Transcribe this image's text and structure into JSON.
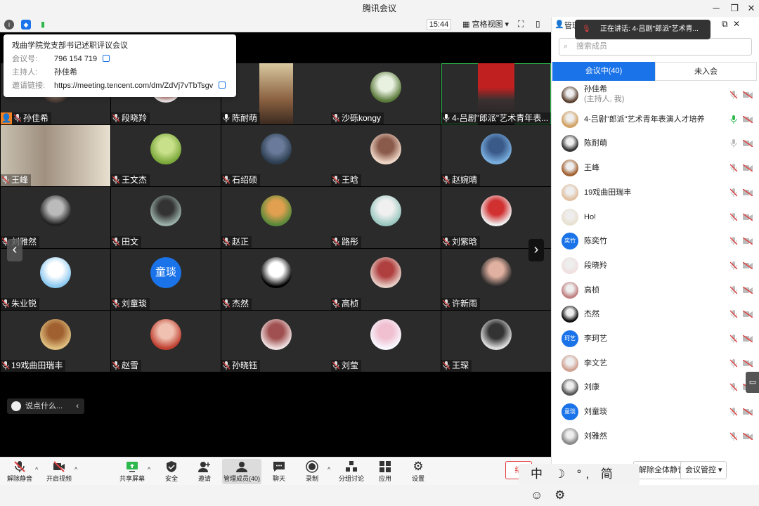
{
  "window": {
    "title": "腾讯会议"
  },
  "toolbar": {
    "time": "15:44",
    "view_mode": "宫格视图"
  },
  "meeting": {
    "subject": "戏曲学院党支部书记述职评议会议",
    "id_label": "会议号:",
    "id": "796 154 719",
    "host_label": "主持人:",
    "host": "孙佳希",
    "link_label": "邀请链接:",
    "link": "https://meeting.tencent.com/dm/ZdVj7vTbTsgv"
  },
  "grid": [
    {
      "name": "孙佳希",
      "host": true
    },
    {
      "name": "段晓羚"
    },
    {
      "name": "陈耐萌",
      "mic": "on"
    },
    {
      "name": "沙砾kongy"
    },
    {
      "name": "4-吕剧\"郎派\"艺术青年表...",
      "mic": "on"
    },
    {
      "name": "王峰"
    },
    {
      "name": "王文杰"
    },
    {
      "name": "石绍硕"
    },
    {
      "name": "王晗"
    },
    {
      "name": "赵婉晴"
    },
    {
      "name": "刘雅然"
    },
    {
      "name": "田文"
    },
    {
      "name": "赵正"
    },
    {
      "name": "路彤"
    },
    {
      "name": "刘紫晗"
    },
    {
      "name": "朱业锐"
    },
    {
      "name": "刘童琰",
      "initials": "童琰"
    },
    {
      "name": "杰然"
    },
    {
      "name": "高桢"
    },
    {
      "name": "许新雨"
    },
    {
      "name": "19戏曲田瑞丰"
    },
    {
      "name": "赵雪"
    },
    {
      "name": "孙晓钰"
    },
    {
      "name": "刘莹"
    },
    {
      "name": "王琛"
    }
  ],
  "chat": {
    "placeholder": "说点什么..."
  },
  "bottom": {
    "unmute": "解除静音",
    "video": "开启视频",
    "share": "共享屏幕",
    "security": "安全",
    "invite": "邀请",
    "members": "管理成员(40)",
    "chat": "聊天",
    "record": "录制",
    "breakout": "分组讨论",
    "apps": "应用",
    "settings": "设置"
  },
  "panel": {
    "title": "管理",
    "speaking": "正在讲话: 4-吕剧\"郎派\"艺术青...",
    "search_placeholder": "搜索成员",
    "tab_in": "会议中(40)",
    "tab_out": "未入会",
    "mute_all": "解除全体静音",
    "control": "会议管控",
    "end_partial": "结",
    "host_sub": "(主持人, 我)",
    "members": [
      {
        "name": "孙佳希",
        "mic": "muted"
      },
      {
        "name": "4-吕剧\"郎派\"艺术青年表演人才培养",
        "mic": "on"
      },
      {
        "name": "陈耐萌",
        "mic": "idle"
      },
      {
        "name": "王峰",
        "mic": "muted"
      },
      {
        "name": "19戏曲田瑞丰",
        "mic": "muted"
      },
      {
        "name": "Ho!",
        "mic": "muted"
      },
      {
        "name": "陈奕竹",
        "mic": "muted",
        "initials": "奕竹"
      },
      {
        "name": "段晓羚",
        "mic": "muted"
      },
      {
        "name": "高桢",
        "mic": "muted"
      },
      {
        "name": "杰然",
        "mic": "muted"
      },
      {
        "name": "李珂艺",
        "mic": "muted",
        "initials": "珂艺"
      },
      {
        "name": "李文艺",
        "mic": "muted"
      },
      {
        "name": "刘康",
        "mic": "muted"
      },
      {
        "name": "刘童琰",
        "mic": "muted",
        "initials": "童琰"
      },
      {
        "name": "刘雅然",
        "mic": "muted"
      }
    ]
  },
  "ime": {
    "text": "中 ☽ °, 简 ☺ ⚙"
  },
  "colors": {
    "accent": "#1a73e8",
    "muted": "#e04040",
    "live": "#2db84d",
    "tile_bg": "#2b2b2b"
  }
}
